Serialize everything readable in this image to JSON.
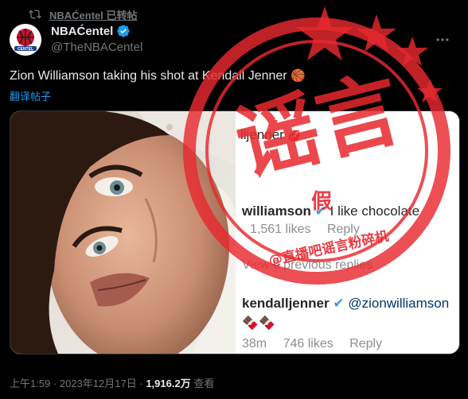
{
  "retweet": {
    "label": "NBAĆentel 已转帖"
  },
  "author": {
    "name": "NBAĆentel",
    "handle": "@TheNBACentel"
  },
  "tweet": {
    "text": "Zion Williamson taking his shot at Kendall Jenner",
    "translate_label": "翻译帖子"
  },
  "instagram": {
    "post_user": "ll​jenner",
    "reply_user": "williamson",
    "reply_text": "I like chocolate",
    "likes": "1,561 likes",
    "reply_label": "Reply",
    "view_replies": "View 6 previous replies",
    "comment_user": "kendalljenner",
    "mention": "@zionwilliamson",
    "comment_time": "38m",
    "comment_likes": "746 likes",
    "comment_reply": "Reply"
  },
  "stamp": {
    "main_text": "谣言",
    "fake_text": "假",
    "credit_text": "@直播吧谣言粉碎机",
    "color": "#e8292f"
  },
  "meta": {
    "time": "上午1:59",
    "date": "2023年12月17日",
    "views": "1,916.2万",
    "views_label": "查看"
  }
}
